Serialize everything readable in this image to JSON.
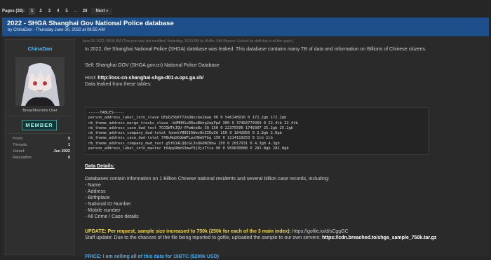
{
  "pagination": {
    "label": "Pages (28):",
    "pages": [
      "1",
      "2",
      "3",
      "4",
      "5"
    ],
    "ellipsis": "...",
    "last": "28",
    "next": "Next »"
  },
  "thread": {
    "title": "2022 - SHGA Shanghai Gov National Police database",
    "meta": "by ChinaDan - Thursday June 30, 2022 at 08:55 AM"
  },
  "author": {
    "username": "ChinaDan",
    "rank": "BreachForums User",
    "badge": "MEMBER",
    "stats": [
      {
        "label": "Posts:",
        "value": "5"
      },
      {
        "label": "Threads:",
        "value": "1"
      },
      {
        "label": "Joined:",
        "value": "Jun 2022"
      },
      {
        "label": "Reputation:",
        "value": "0"
      }
    ]
  },
  "post": {
    "meta": "June 30, 2022, 08:55 AM   (This post was last modified: Yesterday, 10:23 AM by Muffin. Edit Reason: Locked by staff due to all the spam )",
    "intro": "In 2022, the Shanghai National Police (SHGA) database was leaked. This database contains many TB of data and information on Billions of Chinese citizens.",
    "sell": "Sell: Shanghai GOV (SHGA.gov.cn) National Police Database",
    "host_label": "Host: ",
    "host_value": "http://oss-cn-shanghai-shga-d01-a.ops.ga.sh/",
    "leaked_label": "Data leaked from these tables:",
    "code": "-----TABLES-----\nperson_address_label_info_slave QFpD25bKT72eQ8xcbe2Aaw 90 0 546148916 0 172.2gb 172.2gb\nnb_theme_address_merge_tracks_slave -bUMH01uRRuoBbhq2epFpA 300 0 37483779369 0 22.4tb 22.4tb\nnb_theme_address_case_dwd_test 7COIWTtJQU-YPwWxb8z_SQ 150 0 22375506 1749307 25.2gb 25.2gb\nnb_theme_address_company_dwd-total fpnmtYB95I6WevHnZIEwIA 150 0 1842856 0 2.8gb 2.8gb\nnb_theme_address_case_dwd-total 7XBoNqUGQmWFLpzHDmUTbg 150 0 1214119253 0 1tb 1tb\nnb_theme_address_company_dwd_test g5f614LQQcGL3oQGONZ8bw 150 0 2017931 0 4.3gb 4.3gb\nperson_address_label_info_master t64pp9We53mwY9jDjzTtia 90 0 969830088 0 282.8gb 282.8gb",
    "details_heading": "Data Details:",
    "details_intro": "Databases contain information on 1 Billion Chinese national residents and several billion case records, including:",
    "details_items": [
      "- Name",
      "- Address",
      "- Birthplace",
      "- National ID Number",
      "- Mobile number",
      "- All Crime / Case details"
    ],
    "update_label": "UPDATE: Per request, sample size increased to 750k (250k for each of the 3 main index):",
    "update_link": " https://gofile.io/d/sCggGC",
    "staff_text": "Staff update: Due to the chances of the file being reported to gofile, uploaded the sample to our own servers: ",
    "staff_link": "https://cdn.breached.to/shga_sample_750k.tar.gz",
    "price": "PRICE: I am selling all of this data for 10BTC ($200k USD)"
  },
  "colors": {
    "background": "#262626",
    "header_bar": "#1f4f8a",
    "username": "#59b4ee",
    "badge": "#9ff4ef",
    "update": "#f0d84a",
    "price": "#4aa8e8"
  }
}
